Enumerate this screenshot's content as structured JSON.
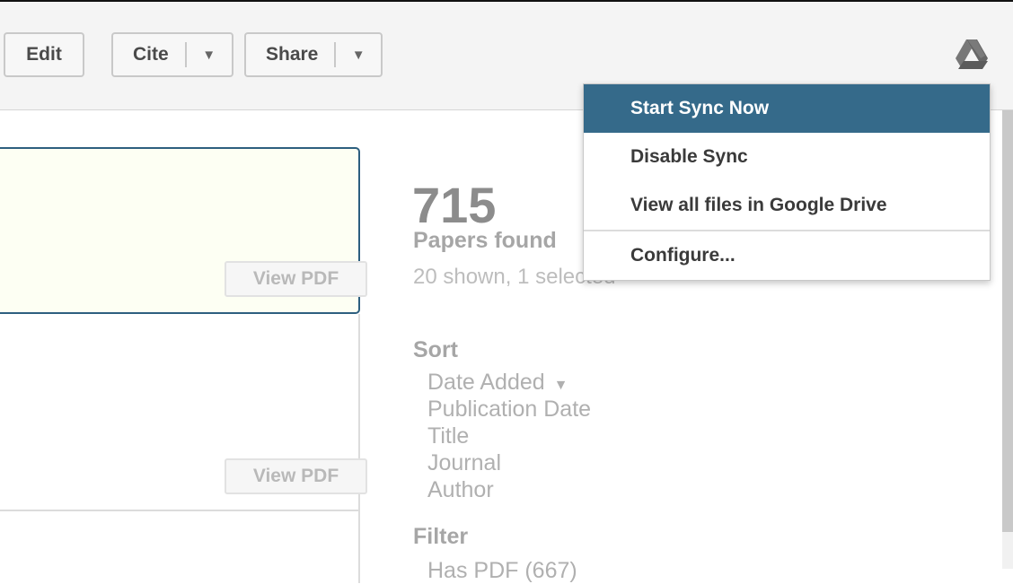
{
  "toolbar": {
    "edit_label": "Edit",
    "cite_label": "Cite",
    "share_label": "Share",
    "caret": "▼"
  },
  "papers": {
    "view_pdf_label": "View PDF"
  },
  "summary": {
    "count": "715",
    "count_label": "Papers found",
    "shown_text": "20 shown, 1 selected"
  },
  "sort": {
    "title": "Sort",
    "caret": "▼",
    "items": [
      "Date Added",
      "Publication Date",
      "Title",
      "Journal",
      "Author"
    ]
  },
  "filter": {
    "title": "Filter",
    "items": [
      "Has PDF (667)"
    ]
  },
  "drive_menu": {
    "items": [
      "Start Sync Now",
      "Disable Sync",
      "View all files in Google Drive",
      "Configure..."
    ]
  },
  "colors": {
    "accent": "#356a8a",
    "card_border": "#2d5f7f",
    "card_bg": "#fdfff3"
  }
}
